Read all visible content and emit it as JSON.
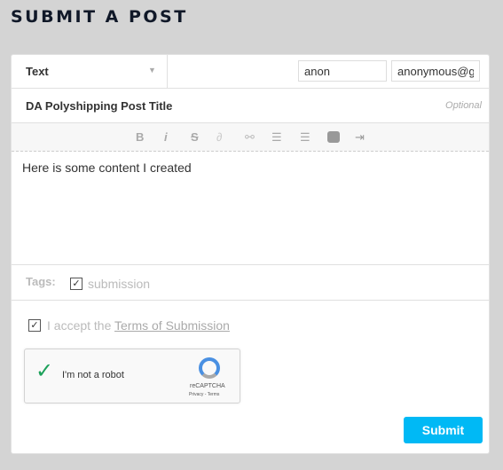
{
  "page_title": "SUBMIT A POST",
  "post_type": {
    "selected": "Text"
  },
  "name_field": {
    "value": "anon"
  },
  "email_field": {
    "value": "anonymous@gm"
  },
  "title_field": {
    "value": "DA Polyshipping Post Title",
    "hint": "Optional"
  },
  "toolbar": {
    "bold": "B",
    "italic": "i",
    "strike": "S"
  },
  "editor": {
    "content": "Here is some content I created"
  },
  "tags": {
    "label": "Tags:",
    "items": [
      {
        "label": "submission",
        "checked": true
      }
    ]
  },
  "terms": {
    "prefix": "I accept the ",
    "link": "Terms of Submission",
    "checked": true
  },
  "captcha": {
    "label": "I'm not a robot",
    "brand": "reCAPTCHA",
    "links": "Privacy - Terms"
  },
  "submit_label": "Submit",
  "colors": {
    "accent": "#00b9f5",
    "heading": "#101828"
  }
}
